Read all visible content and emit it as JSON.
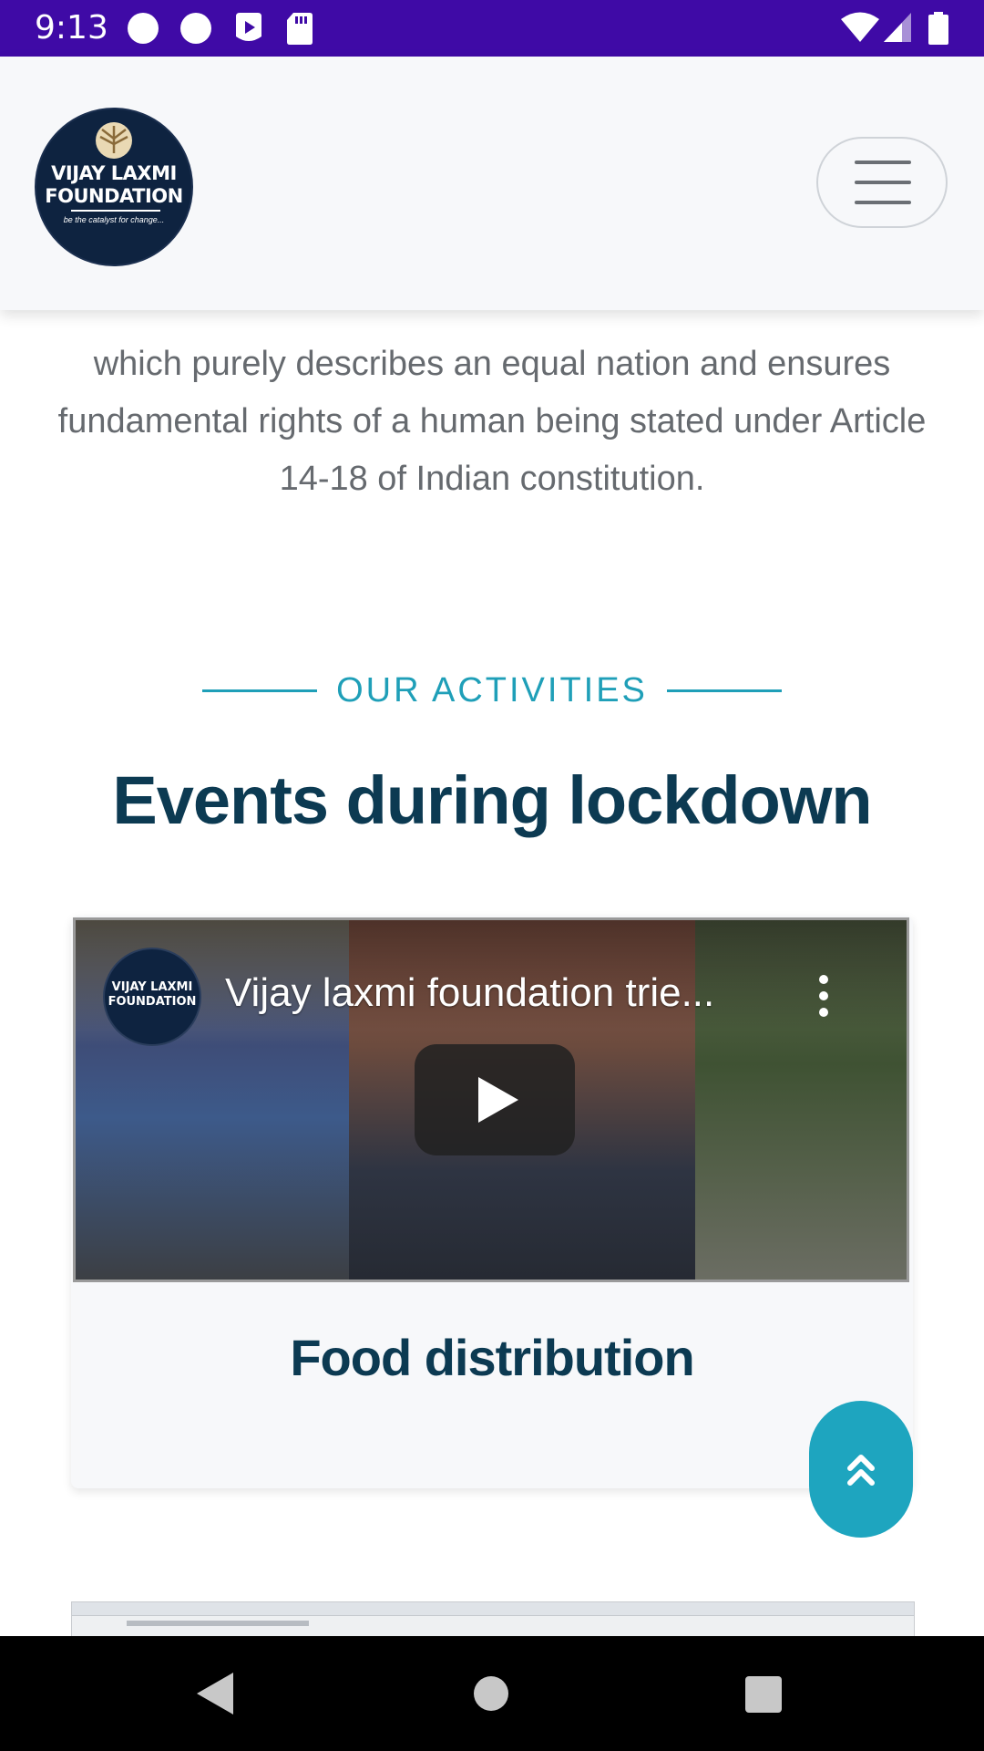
{
  "status_bar": {
    "time": "9:13",
    "left_icons": [
      "notification-dot-icon",
      "notification-dot-icon",
      "play-store-icon",
      "sd-card-icon"
    ],
    "right_icons": [
      "wifi-icon",
      "signal-icon",
      "battery-icon"
    ]
  },
  "header": {
    "logo_line1": "VIJAY LAXMI",
    "logo_line2": "FOUNDATION",
    "logo_tagline": "be the catalyst for change...",
    "menu_icon": "hamburger-icon"
  },
  "intro": {
    "text": "which purely describes an equal nation and ensures fundamental rights of a human being stated under Article 14-18 of Indian constitution."
  },
  "section": {
    "eyebrow": "OUR ACTIVITIES",
    "title": "Events during lockdown"
  },
  "card": {
    "video": {
      "title": "Vijay laxmi foundation trie...",
      "channel_line1": "VIJAY LAXMI",
      "channel_line2": "FOUNDATION",
      "play_icon": "play-icon",
      "more_icon": "more-vert-icon"
    },
    "title": "Food distribution"
  },
  "scroll_top": {
    "icon": "double-chevron-up-icon"
  },
  "nav_bar": {
    "back_icon": "back-icon",
    "home_icon": "home-icon",
    "recents_icon": "recents-icon"
  },
  "colors": {
    "status_bar": "#3f0aa6",
    "accent": "#1f9fb8",
    "heading": "#0c3a52",
    "body_text": "#666a6f"
  }
}
